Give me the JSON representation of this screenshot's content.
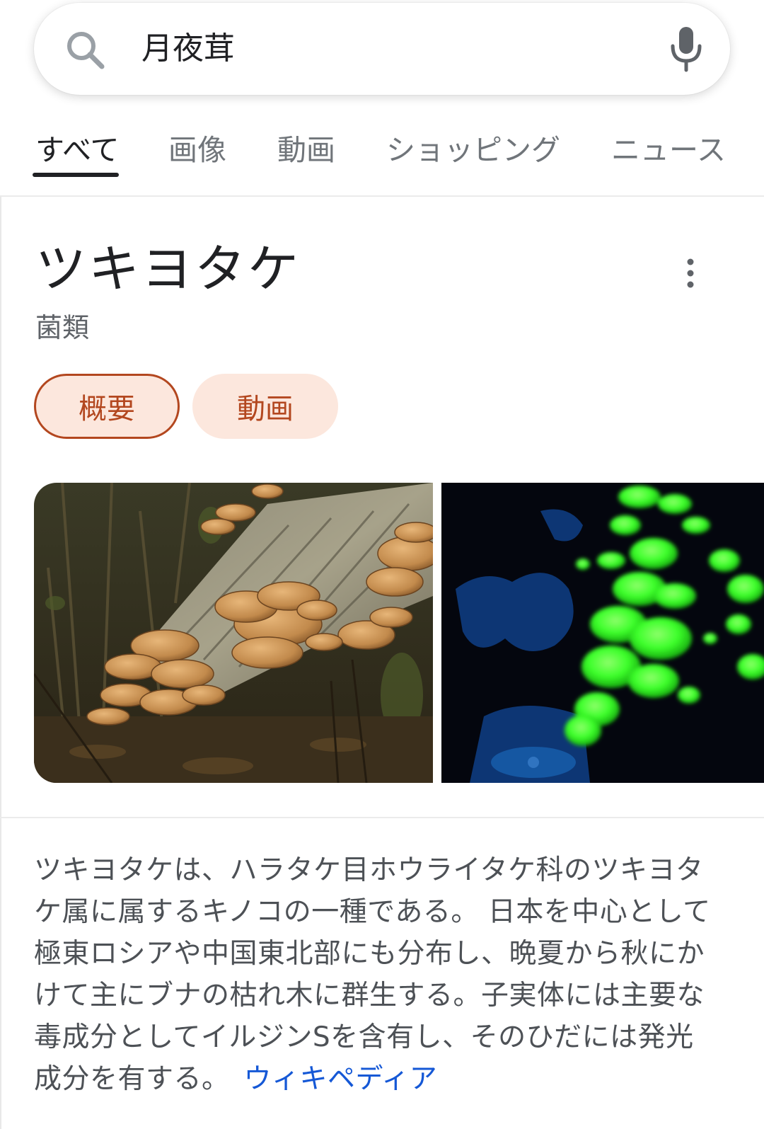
{
  "search": {
    "query": "月夜茸"
  },
  "tabs": [
    {
      "label": "すべて",
      "active": true
    },
    {
      "label": "画像",
      "active": false
    },
    {
      "label": "動画",
      "active": false
    },
    {
      "label": "ショッピング",
      "active": false
    },
    {
      "label": "ニュース",
      "active": false
    }
  ],
  "knowledge_panel": {
    "title": "ツキヨタケ",
    "subtitle": "菌類",
    "chips": [
      {
        "label": "概要",
        "selected": true
      },
      {
        "label": "動画",
        "selected": false
      }
    ],
    "images": [
      {
        "description_icon": "mushrooms-on-log-image"
      },
      {
        "description_icon": "glowing-mushrooms-image"
      }
    ],
    "description": "ツキヨタケは、ハラタケ目ホウライタケ科のツキヨタケ属に属するキノコの一種である。 日本を中心として極東ロシアや中国東北部にも分布し、晩夏から秋にかけて主にブナの枯れ木に群生する。子実体には主要な毒成分としてイルジンSを含有し、そのひだには発光成分を有する。",
    "source_link": "ウィキペディア"
  },
  "colors": {
    "accent_chip_text": "#b3471f",
    "accent_chip_bg": "#fce7dd",
    "link": "#1558d6",
    "glow_green": "#3cff2a"
  }
}
